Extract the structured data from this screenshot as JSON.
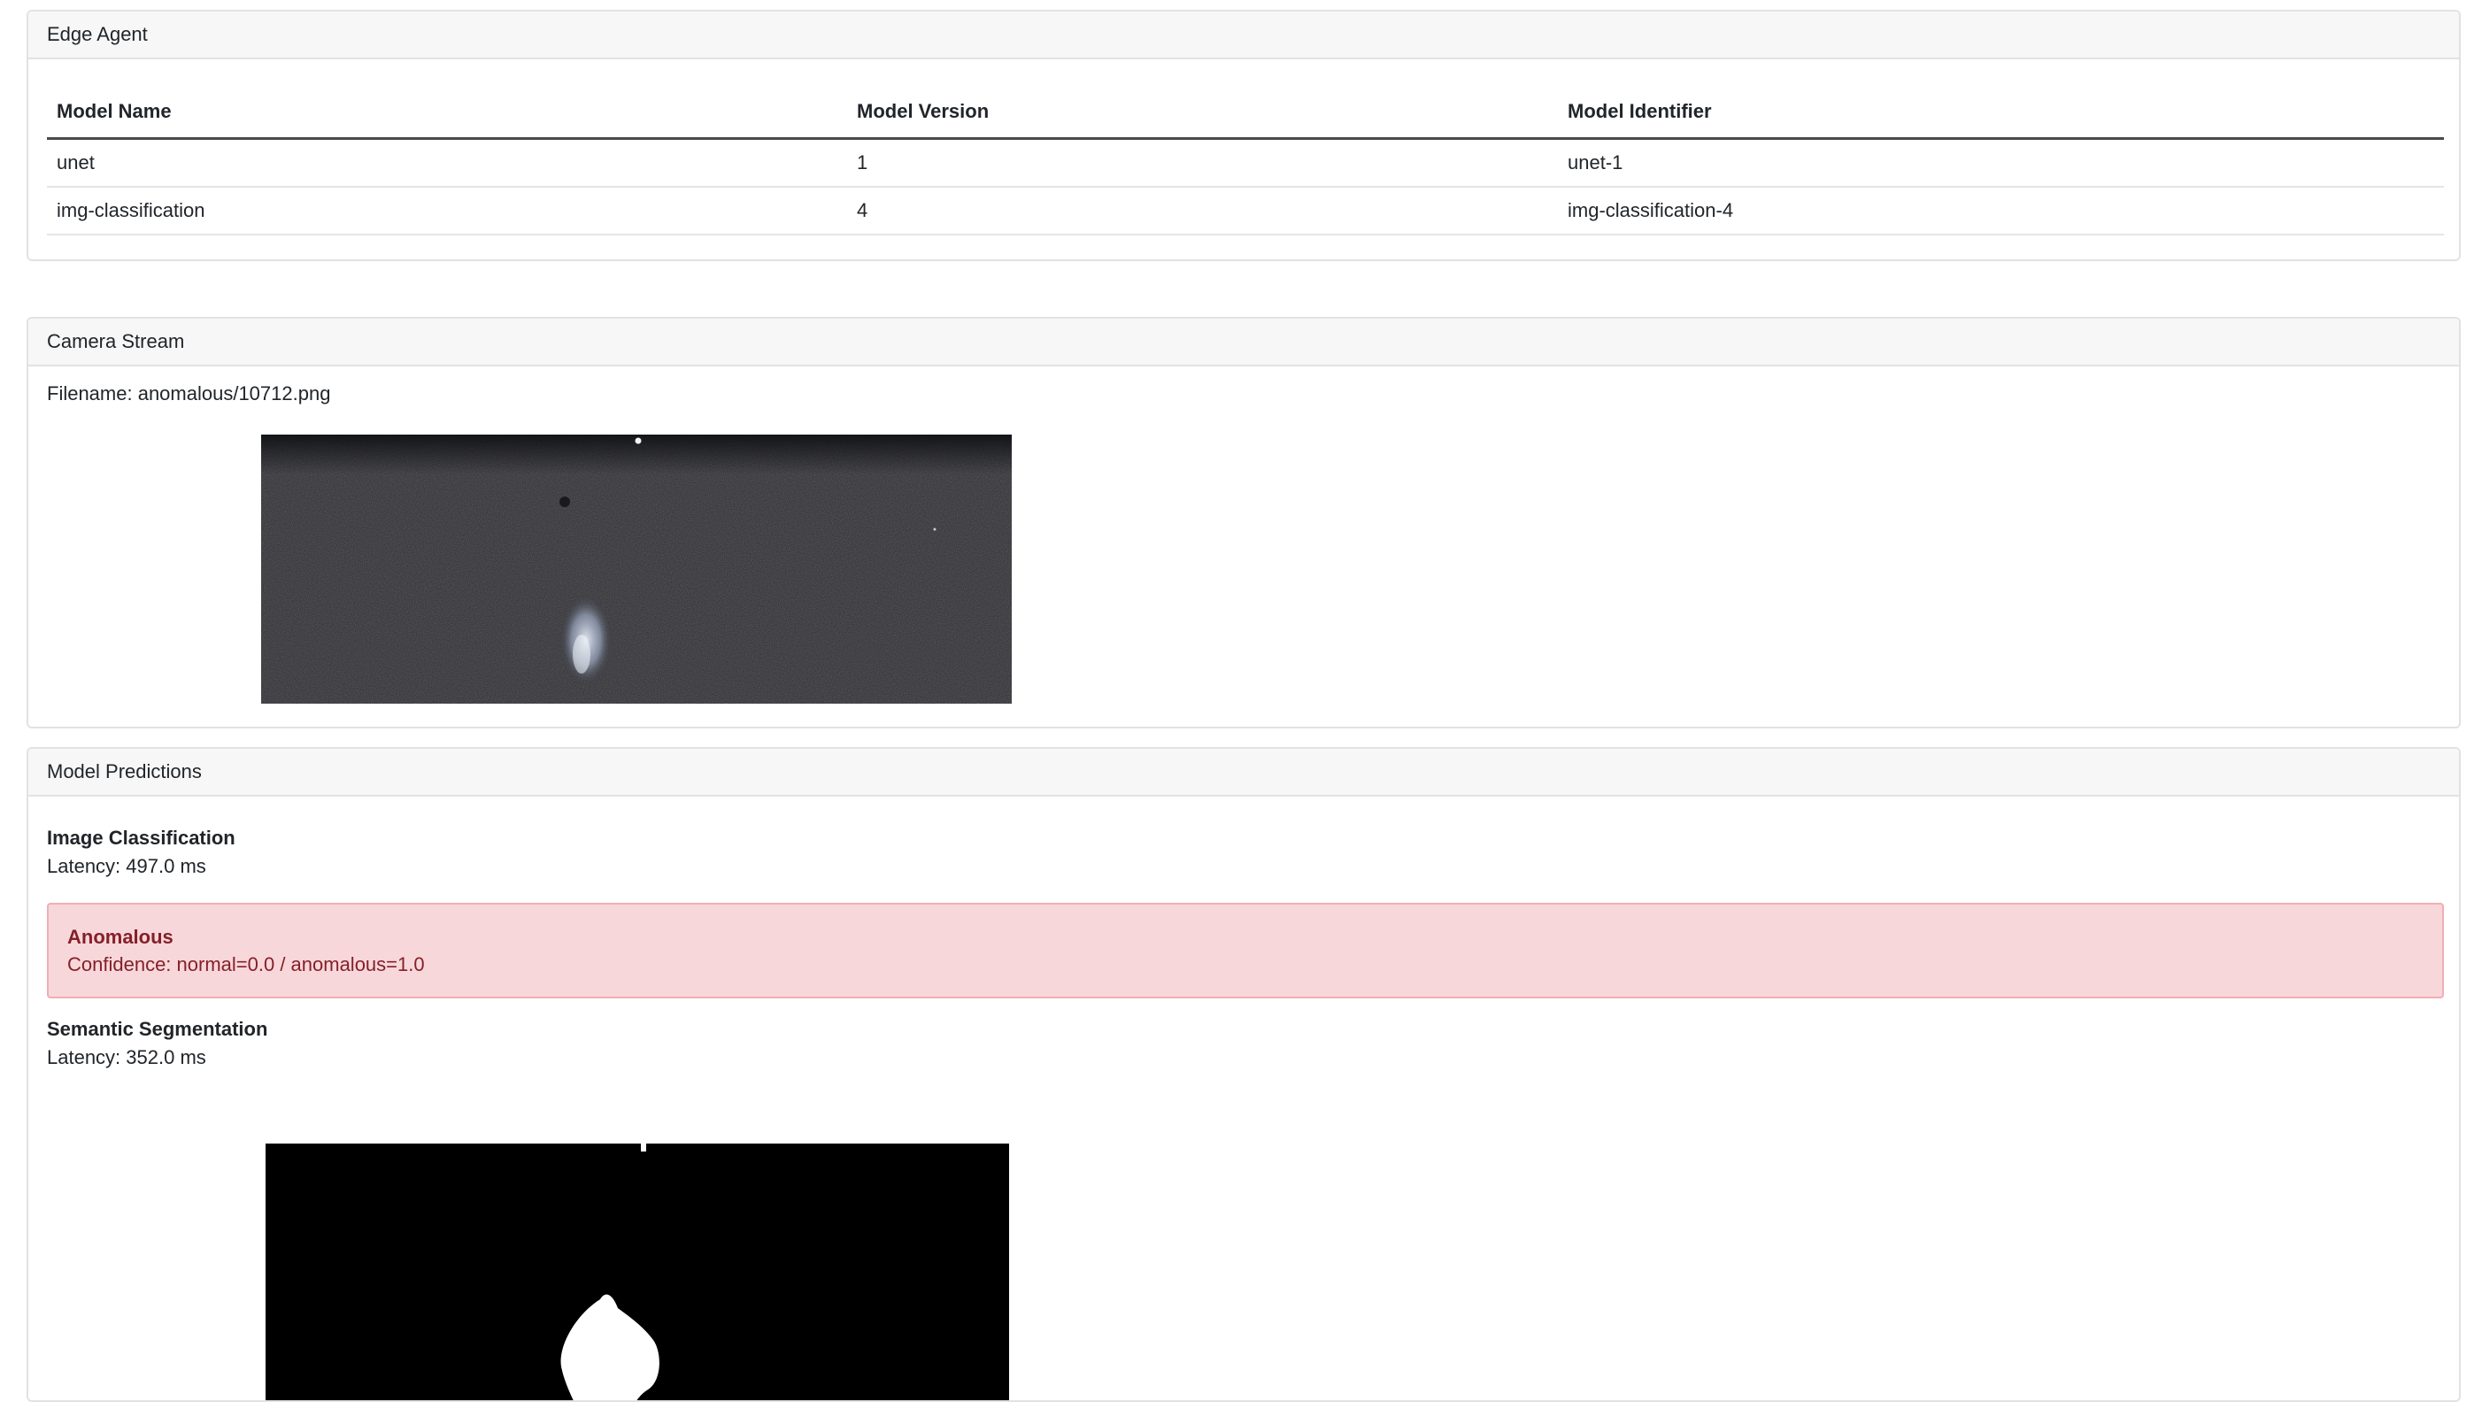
{
  "edge_agent": {
    "header": "Edge Agent",
    "columns": [
      "Model Name",
      "Model Version",
      "Model Identifier"
    ],
    "rows": [
      [
        "unet",
        "1",
        "unet-1"
      ],
      [
        "img-classification",
        "4",
        "img-classification-4"
      ]
    ]
  },
  "camera": {
    "header": "Camera Stream",
    "filename_text": "Filename: anomalous/10712.png"
  },
  "predictions": {
    "header": "Model Predictions",
    "classification": {
      "title": "Image Classification",
      "latency": "Latency: 497.0 ms",
      "result_label": "Anomalous",
      "confidence": "Confidence: normal=0.0 / anomalous=1.0"
    },
    "segmentation": {
      "title": "Semantic Segmentation",
      "latency": "Latency: 352.0 ms"
    }
  },
  "colors": {
    "alert_bg": "#f8d7da",
    "alert_text": "#842029"
  }
}
